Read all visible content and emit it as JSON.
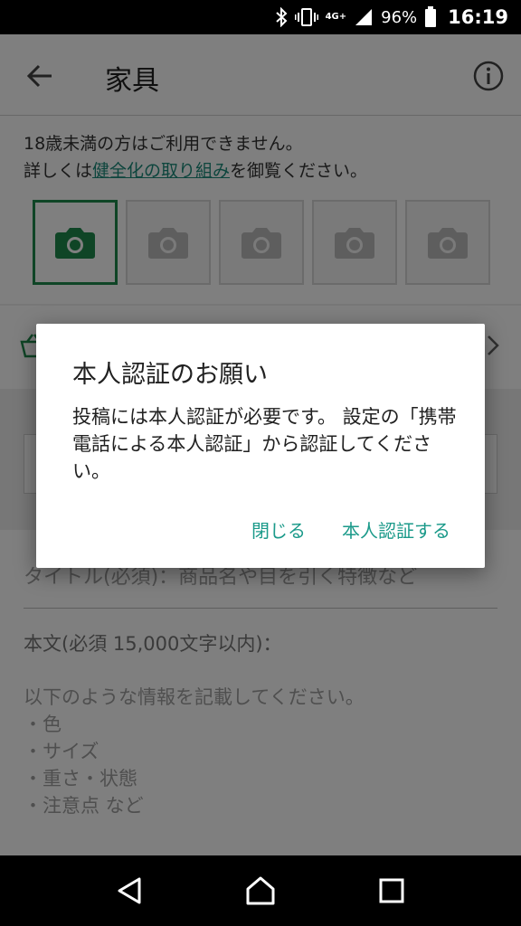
{
  "status_bar": {
    "network": "4G+",
    "battery_percent": "96%",
    "time": "16:19"
  },
  "app_bar": {
    "title": "家具",
    "back_icon": "arrow-left-icon",
    "info_icon": "info-icon"
  },
  "notice": {
    "line1": "18歳未満の方はご利用できません。",
    "line2_prefix": "詳しくは",
    "link_text": "健全化の取り組み",
    "line2_suffix": "を御覧ください。"
  },
  "photo_slots": {
    "count": 5,
    "icon": "camera-icon"
  },
  "form": {
    "title_placeholder": "タイトル(必須)：商品名や目を引く特徴など",
    "body_label": "本文(必須 15,000文字以内)：",
    "body_hint_intro": "以下のような情報を記載してください。",
    "body_hint_items": [
      "・色",
      "・サイズ",
      "・重さ・状態",
      "・注意点 など"
    ]
  },
  "dialog": {
    "title": "本人認証のお願い",
    "message": "投稿には本人認証が必要です。 設定の「携帯電話による本人認証」から認証してください。",
    "close_label": "閉じる",
    "verify_label": "本人認証する"
  },
  "colors": {
    "accent": "#1b9a8a",
    "camera_active": "#1f8a4c",
    "camera_inactive": "#bdbdbd"
  }
}
